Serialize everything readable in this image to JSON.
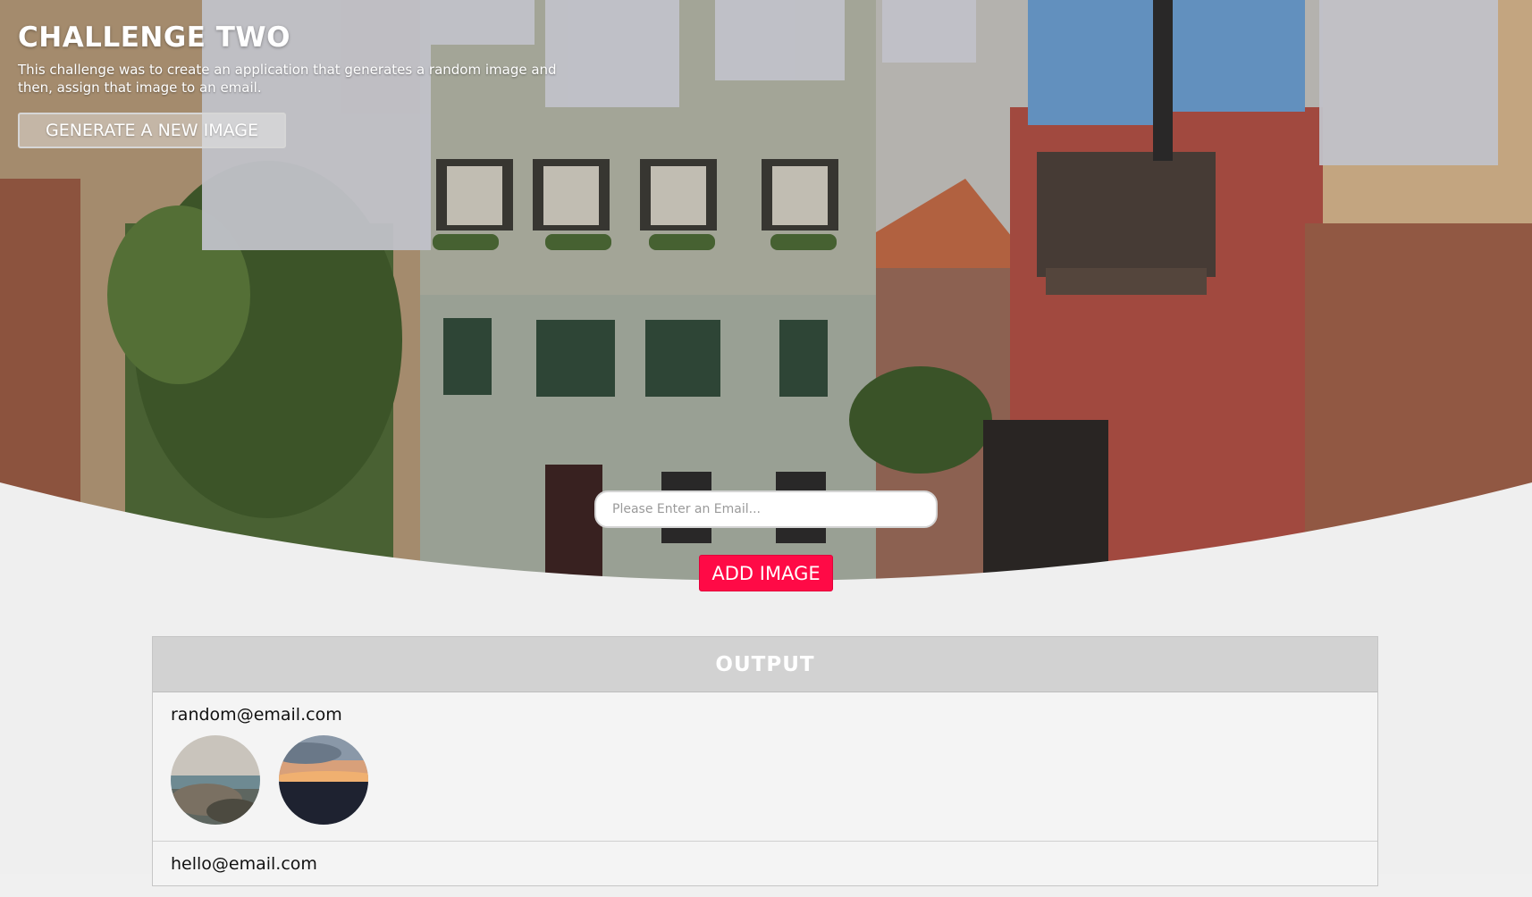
{
  "header": {
    "title": "CHALLENGE TWO",
    "description": "This challenge was to create an application that generates a random image and then, assign that image to an email.",
    "generate_button": "GENERATE A NEW IMAGE"
  },
  "form": {
    "email_placeholder": "Please Enter an Email...",
    "add_button": "ADD IMAGE"
  },
  "output": {
    "title": "OUTPUT",
    "entries": [
      {
        "email": "random@email.com",
        "images": [
          "rocky-coast-thumbnail",
          "sunset-sky-thumbnail"
        ]
      },
      {
        "email": "hello@email.com",
        "images": []
      }
    ]
  },
  "colors": {
    "accent": "#ff0a46",
    "panel_header": "#d2d2d2",
    "background": "#efefef"
  }
}
